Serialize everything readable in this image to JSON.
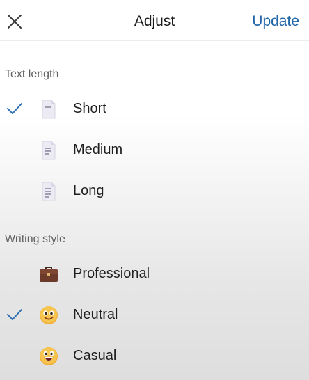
{
  "header": {
    "title": "Adjust",
    "update_label": "Update",
    "close_icon": "close-icon"
  },
  "text_length": {
    "label": "Text length",
    "options": [
      {
        "label": "Short",
        "icon": "document-short-icon",
        "selected": true
      },
      {
        "label": "Medium",
        "icon": "document-medium-icon",
        "selected": false
      },
      {
        "label": "Long",
        "icon": "document-long-icon",
        "selected": false
      }
    ]
  },
  "writing_style": {
    "label": "Writing style",
    "options": [
      {
        "label": "Professional",
        "icon": "briefcase-icon",
        "selected": false
      },
      {
        "label": "Neutral",
        "icon": "smiling-face-icon",
        "selected": true
      },
      {
        "label": "Casual",
        "icon": "grinning-face-icon",
        "selected": false
      }
    ]
  },
  "colors": {
    "accent": "#2166a8",
    "check": "#2b6cb0",
    "text": "#1f1f1f",
    "section_label": "#5f5f5f"
  }
}
